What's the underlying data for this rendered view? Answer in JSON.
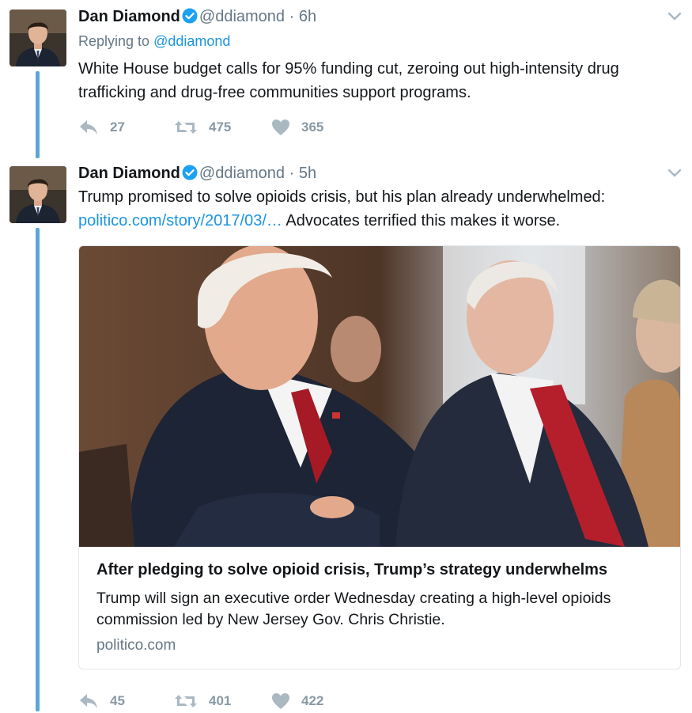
{
  "colors": {
    "link": "#1b95e0",
    "meta": "#657786",
    "thread": "#5aa7d6",
    "actions": "#8899a6"
  },
  "tweets": [
    {
      "author_name": "Dan Diamond",
      "handle": "@ddiamond",
      "separator": "·",
      "time": "6h",
      "replying_prefix": "Replying to",
      "replying_to": "@ddiamond",
      "text": "White House budget calls for 95% funding cut, zeroing out high-intensity drug trafficking and drug-free communities support programs.",
      "replies": "27",
      "retweets": "475",
      "likes": "365"
    },
    {
      "author_name": "Dan Diamond",
      "handle": "@ddiamond",
      "separator": "·",
      "time": "5h",
      "text_before": "Trump promised to solve opioids crisis, but his plan already underwhelmed: ",
      "link_text": "politico.com/story/2017/03/…",
      "text_after": " Advocates terrified this makes it worse.",
      "card": {
        "title": "After pledging to solve opioid crisis, Trump’s strategy underwhelms",
        "description": "Trump will sign an executive order Wednesday creating a high-level opioids commission led by New Jersey Gov. Chris Christie.",
        "domain": "politico.com"
      },
      "replies": "45",
      "retweets": "401",
      "likes": "422"
    }
  ]
}
